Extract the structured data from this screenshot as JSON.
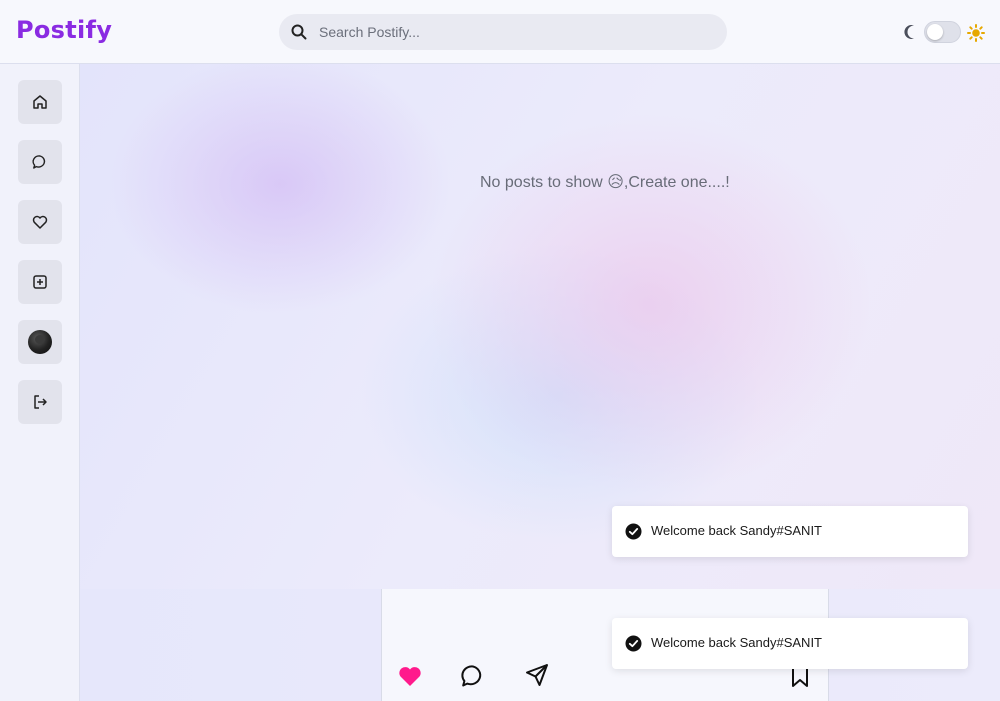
{
  "app": {
    "name": "Postify"
  },
  "header": {
    "search_placeholder": "Search Postify...",
    "theme_toggle": {
      "dark_icon": "moon-icon",
      "light_icon": "sun-icon",
      "state": "off"
    }
  },
  "sidebar": {
    "items": [
      {
        "id": "home",
        "icon": "home-icon"
      },
      {
        "id": "messages",
        "icon": "chat-bubble-icon"
      },
      {
        "id": "notifications",
        "icon": "heart-icon"
      },
      {
        "id": "create",
        "icon": "plus-square-icon"
      },
      {
        "id": "profile",
        "icon": "avatar"
      },
      {
        "id": "logout",
        "icon": "logout-icon"
      }
    ]
  },
  "main": {
    "empty_text": "No posts to show",
    "empty_emoji": "😥",
    "empty_suffix": ",Create one....!"
  },
  "post_actions": [
    {
      "id": "like",
      "icon": "heart-filled-icon",
      "active": true
    },
    {
      "id": "comment",
      "icon": "comment-icon"
    },
    {
      "id": "share",
      "icon": "send-icon"
    },
    {
      "id": "save",
      "icon": "bookmark-icon"
    }
  ],
  "toasts": [
    {
      "message": "Welcome back Sandy#SANIT",
      "icon": "check-circle-icon"
    },
    {
      "message": "Welcome back Sandy#SANIT",
      "icon": "check-circle-icon"
    }
  ],
  "colors": {
    "brand": "#8a2be2",
    "like_active": "#ff1a8c",
    "sun": "#e6a800"
  }
}
